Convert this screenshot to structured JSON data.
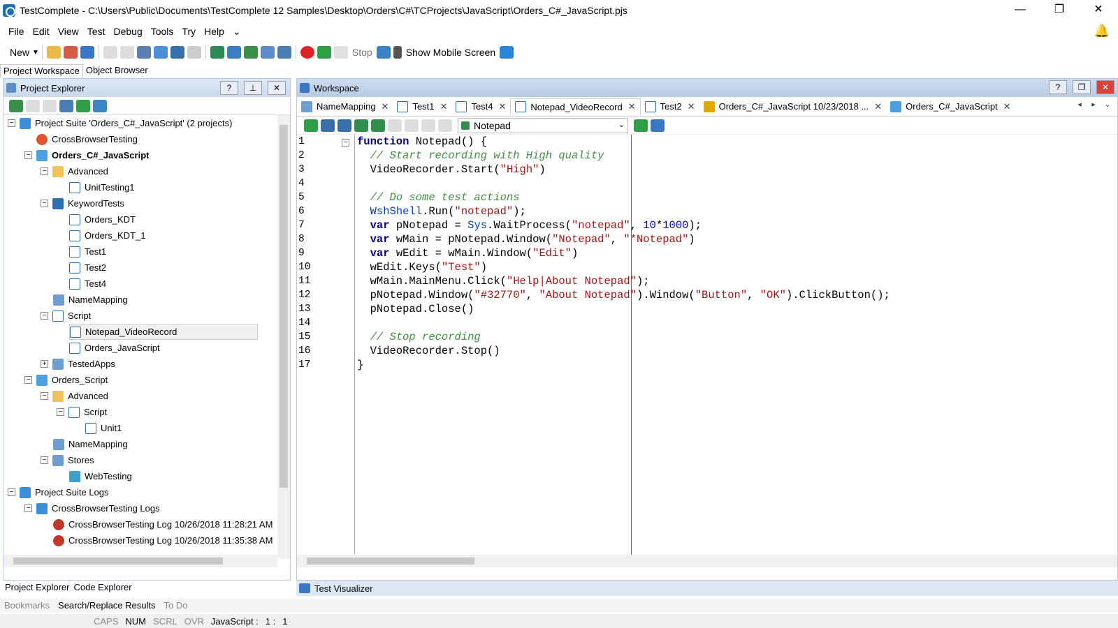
{
  "window": {
    "title": "TestComplete - C:\\Users\\Public\\Documents\\TestComplete 12 Samples\\Desktop\\Orders\\C#\\TCProjects\\JavaScript\\Orders_C#_JavaScript.pjs",
    "minimize": "—",
    "restore": "❐",
    "close": "✕"
  },
  "menu": [
    "File",
    "Edit",
    "View",
    "Test",
    "Debug",
    "Tools",
    "Try",
    "Help"
  ],
  "toolbar": {
    "new_label": "New",
    "stop_label": "Stop",
    "show_mobile_label": "Show Mobile Screen"
  },
  "left_tabs": [
    "Project Workspace",
    "Object Browser"
  ],
  "project_explorer": {
    "title": "Project Explorer",
    "help": "?",
    "pin": "⊥",
    "close": "✕",
    "tree": [
      {
        "label": "Project Suite 'Orders_C#_JavaScript' (2 projects)",
        "icon": "suite-icon"
      },
      {
        "label": "CrossBrowserTesting",
        "icon": "crossbrowser-icon"
      },
      {
        "label": "Orders_C#_JavaScript",
        "icon": "project-icon"
      },
      {
        "label": "Advanced",
        "icon": "folder-icon"
      },
      {
        "label": "UnitTesting1",
        "icon": "unit-test-icon"
      },
      {
        "label": "KeywordTests",
        "icon": "keyword-tests-icon"
      },
      {
        "label": "Orders_KDT",
        "icon": "keyword-test-icon"
      },
      {
        "label": "Orders_KDT_1",
        "icon": "keyword-test-icon"
      },
      {
        "label": "Test1",
        "icon": "keyword-test-icon"
      },
      {
        "label": "Test2",
        "icon": "keyword-test-icon"
      },
      {
        "label": "Test4",
        "icon": "keyword-test-icon"
      },
      {
        "label": "NameMapping",
        "icon": "name-mapping-icon"
      },
      {
        "label": "Script",
        "icon": "script-folder-icon"
      },
      {
        "label": "Notepad_VideoRecord",
        "icon": "script-unit-icon"
      },
      {
        "label": "Orders_JavaScript",
        "icon": "script-unit-icon"
      },
      {
        "label": "TestedApps",
        "icon": "tested-apps-icon"
      },
      {
        "label": "Orders_Script",
        "icon": "project-icon"
      },
      {
        "label": "Advanced",
        "icon": "folder-icon"
      },
      {
        "label": "Script",
        "icon": "script-folder-icon"
      },
      {
        "label": "Unit1",
        "icon": "script-unit-icon"
      },
      {
        "label": "NameMapping",
        "icon": "name-mapping-icon"
      },
      {
        "label": "Stores",
        "icon": "stores-icon"
      },
      {
        "label": "WebTesting",
        "icon": "web-testing-icon"
      },
      {
        "label": "Project Suite Logs",
        "icon": "logs-icon"
      },
      {
        "label": "CrossBrowserTesting Logs",
        "icon": "logs-icon"
      },
      {
        "label": "CrossBrowserTesting Log 10/26/2018 11:28:21 AM",
        "icon": "log-error-icon"
      },
      {
        "label": "CrossBrowserTesting Log 10/26/2018 11:35:38 AM",
        "icon": "log-error-icon"
      }
    ]
  },
  "left_bottom_tabs": [
    "Project Explorer",
    "Code Explorer"
  ],
  "workspace": {
    "title": "Workspace",
    "tabs": [
      {
        "label": "NameMapping",
        "icon": "name-mapping-icon"
      },
      {
        "label": "Test1",
        "icon": "keyword-test-icon"
      },
      {
        "label": "Test4",
        "icon": "keyword-test-icon"
      },
      {
        "label": "Notepad_VideoRecord",
        "icon": "script-unit-icon"
      },
      {
        "label": "Test2",
        "icon": "keyword-test-icon"
      },
      {
        "label": "Orders_C#_JavaScript 10/23/2018 ...",
        "icon": "log-icon"
      },
      {
        "label": "Orders_C#_JavaScript",
        "icon": "project-icon"
      }
    ],
    "routine": "Notepad"
  },
  "code_lines": [
    "1",
    "2",
    "3",
    "4",
    "5",
    "6",
    "7",
    "8",
    "9",
    "10",
    "11",
    "12",
    "13",
    "14",
    "15",
    "16",
    "17"
  ],
  "test_visualizer": "Test Visualizer",
  "bottom_tabs": [
    "Bookmarks",
    "Search/Replace Results",
    "To Do"
  ],
  "status": [
    "CAPS",
    "NUM",
    "SCRL",
    "OVR",
    "JavaScript :",
    "1 :",
    "1"
  ]
}
